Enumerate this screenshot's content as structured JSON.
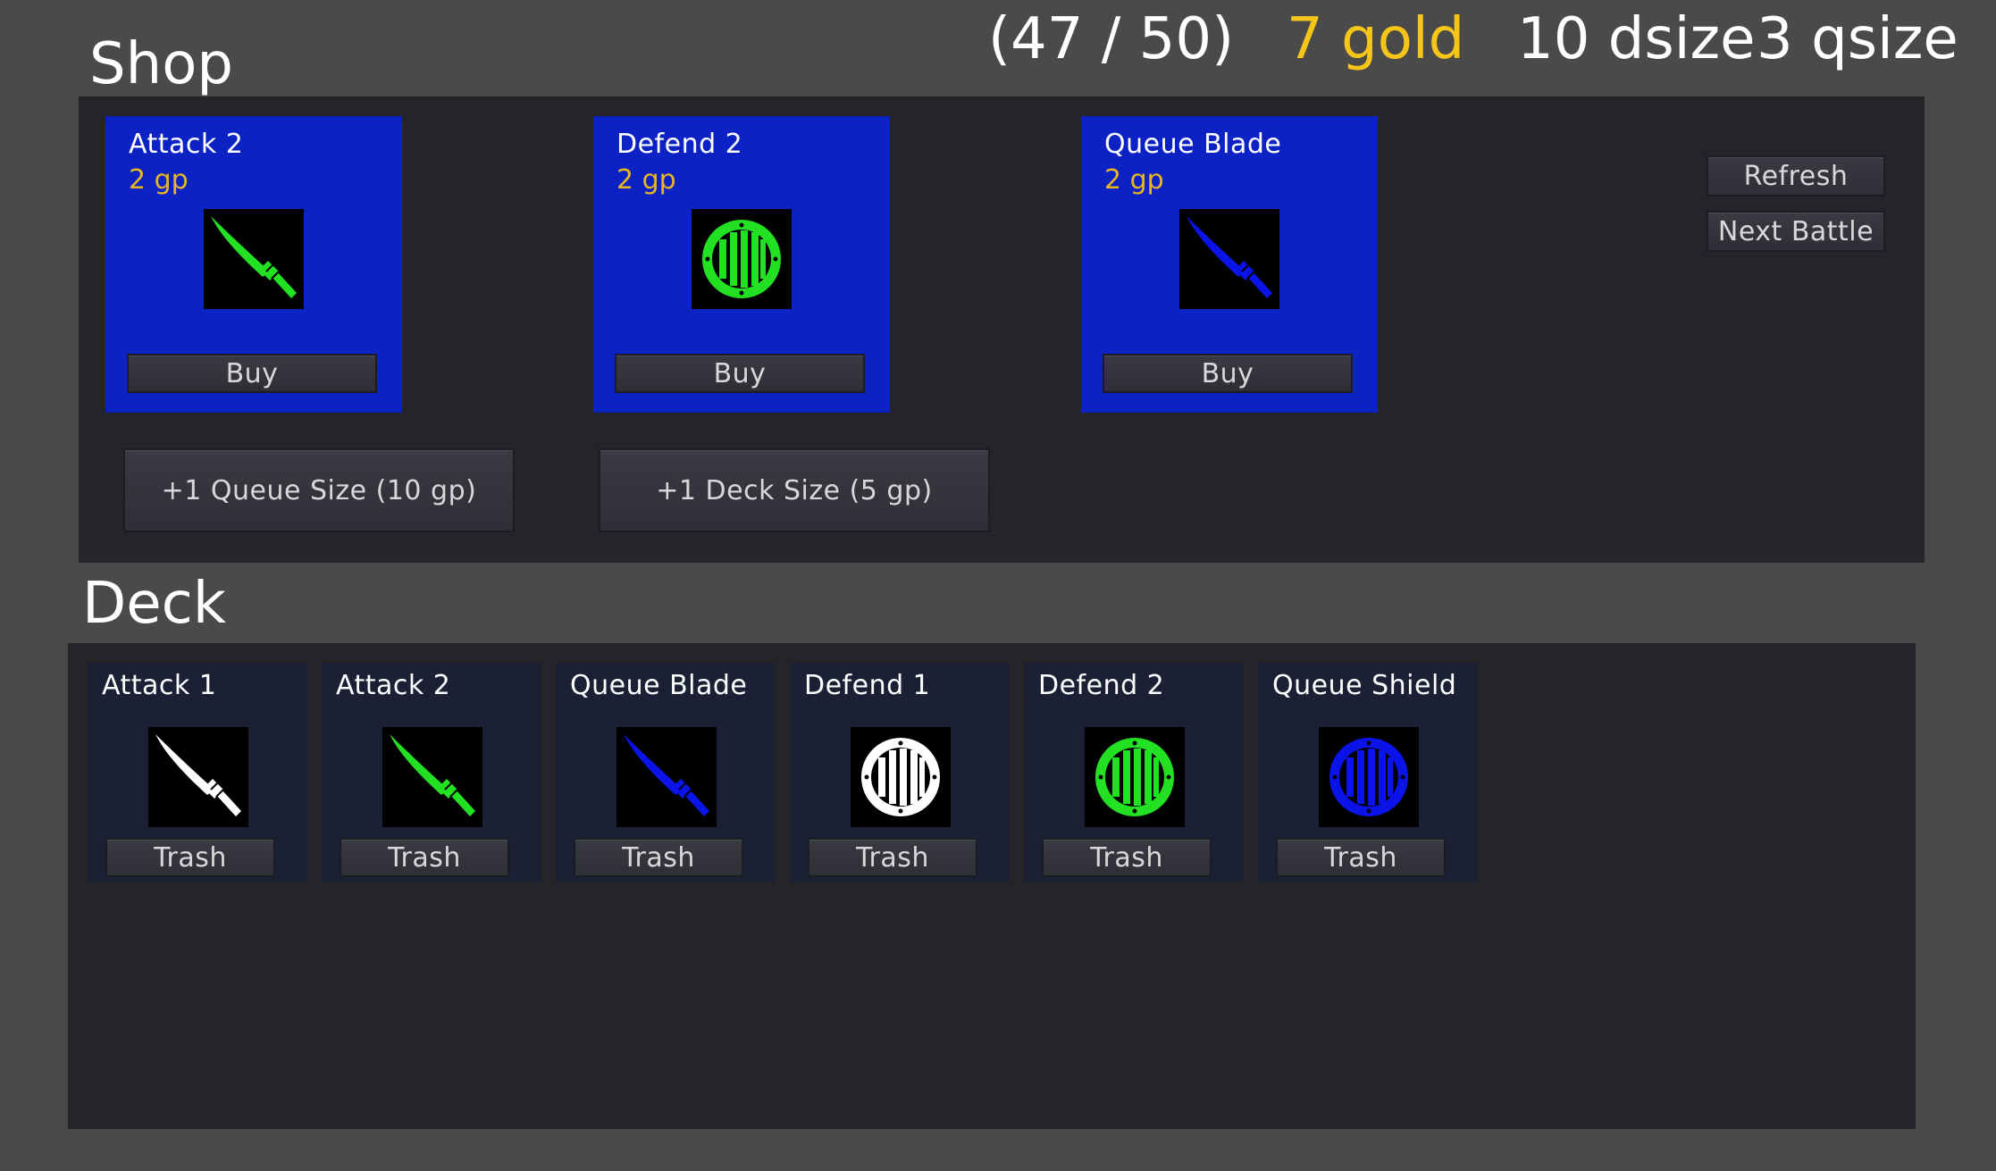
{
  "hud": {
    "progress": "(47 / 50)",
    "gold": "7 gold",
    "dsize": "10 dsize",
    "qsize": "3 qsize"
  },
  "shop": {
    "title": "Shop",
    "items": [
      {
        "name": "Attack 2",
        "price": "2 gp",
        "icon": "sword-icon",
        "color": "#22e022",
        "buy_label": "Buy"
      },
      {
        "name": "Defend 2",
        "price": "2 gp",
        "icon": "shield-icon",
        "color": "#22e022",
        "buy_label": "Buy"
      },
      {
        "name": "Queue Blade",
        "price": "2 gp",
        "icon": "sword-icon",
        "color": "#0a14e8",
        "buy_label": "Buy"
      }
    ],
    "refresh_label": "Refresh",
    "next_battle_label": "Next Battle",
    "queue_upgrade_label": "+1 Queue Size (10 gp)",
    "deck_upgrade_label": "+1 Deck Size (5 gp)"
  },
  "deck": {
    "title": "Deck",
    "cards": [
      {
        "name": "Attack 1",
        "icon": "sword-icon",
        "color": "#ffffff",
        "trash_label": "Trash"
      },
      {
        "name": "Attack 2",
        "icon": "sword-icon",
        "color": "#22e022",
        "trash_label": "Trash"
      },
      {
        "name": "Queue Blade",
        "icon": "sword-icon",
        "color": "#0a14e8",
        "trash_label": "Trash"
      },
      {
        "name": "Defend 1",
        "icon": "shield-icon",
        "color": "#ffffff",
        "trash_label": "Trash"
      },
      {
        "name": "Defend 2",
        "icon": "shield-icon",
        "color": "#22e022",
        "trash_label": "Trash"
      },
      {
        "name": "Queue Shield",
        "icon": "shield-icon",
        "color": "#0a14e8",
        "trash_label": "Trash"
      }
    ]
  },
  "colors": {
    "background": "#4a4a4a",
    "panel": "#242429",
    "shop_card": "#0c22c4",
    "deck_card": "#1c2035",
    "gold": "#f5c518",
    "price": "#e8b620"
  }
}
